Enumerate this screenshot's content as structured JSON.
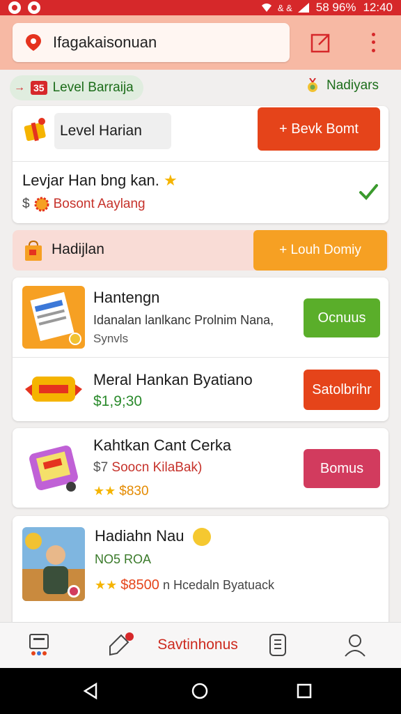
{
  "status_bar": {
    "network": "& &",
    "signal_text": "58 96%",
    "time": "12:40"
  },
  "header": {
    "search_text": "Ifagakaisonuan",
    "accent": "#d6282a",
    "header_bg": "#f7b9a4"
  },
  "subbar": {
    "level_number": "35",
    "level_label": "Level Barraija",
    "hadiah_label": "Nadiyars"
  },
  "level_card": {
    "chip_label": "Level Harian",
    "button_label": "+ Bevk Bomt",
    "row_title": "Levjar Han bng kan.",
    "row_currency": "$",
    "row_subtitle": "Bosont Aaylang"
  },
  "hadiah_bar": {
    "title": "Hadijlan",
    "button_label": "+ Louh Domiy"
  },
  "items": [
    {
      "title": "Hantengn",
      "line1": "Idanalan lanlkanc Prolnim Nana,",
      "line2": "Synvls",
      "button": "Ocnuus"
    },
    {
      "title": "Meral Hankan Byatiano",
      "price": "$1,9;30",
      "button": "Satolbrihr"
    },
    {
      "title": "Kahtkan Cant Cerka",
      "line1_currency": "$7",
      "line1": "Soocn KilaBak)",
      "rating_price": "$830",
      "button": "Bomus"
    },
    {
      "title": "Hadiahn Nau",
      "line1": "NO5 ROA",
      "rating_price": "$8500",
      "rating_suffix": "n Hcedaln Byatuack"
    }
  ],
  "bottom_nav": {
    "center_label": "Savtinhonus",
    "badge_icon": "notification-badge"
  }
}
